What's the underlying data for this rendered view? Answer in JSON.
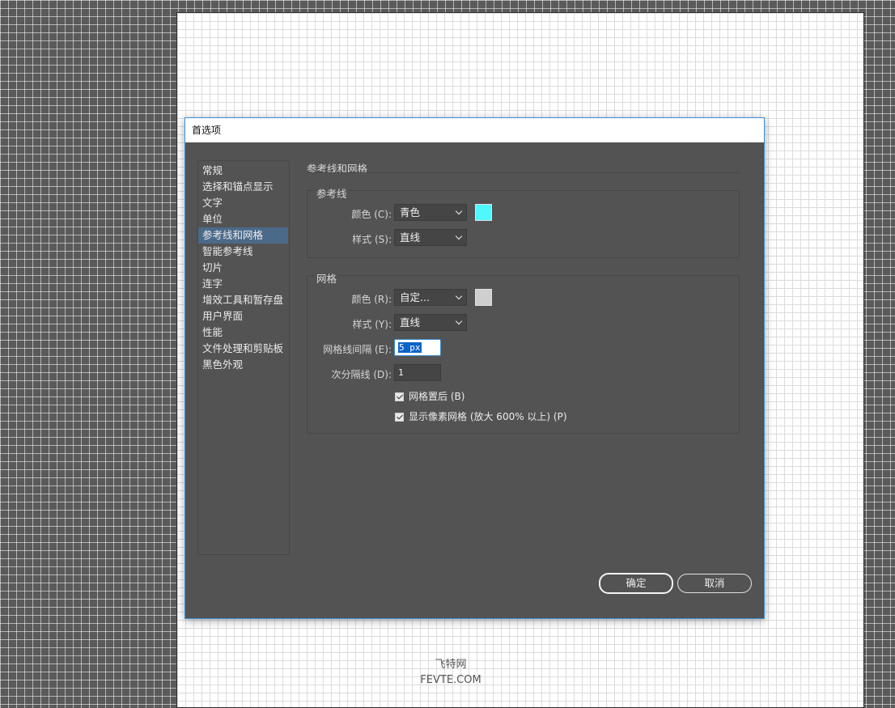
{
  "dialog": {
    "title": "首选项"
  },
  "sidebar": {
    "items": [
      {
        "label": "常规"
      },
      {
        "label": "选择和锚点显示"
      },
      {
        "label": "文字"
      },
      {
        "label": "单位"
      },
      {
        "label": "参考线和网格",
        "active": true
      },
      {
        "label": "智能参考线"
      },
      {
        "label": "切片"
      },
      {
        "label": "连字"
      },
      {
        "label": "增效工具和暂存盘"
      },
      {
        "label": "用户界面"
      },
      {
        "label": "性能"
      },
      {
        "label": "文件处理和剪贴板"
      },
      {
        "label": "黑色外观"
      }
    ]
  },
  "section_title": "参考线和网格",
  "guides": {
    "title": "参考线",
    "color_label": "颜色 (C):",
    "color_value": "青色",
    "color_swatch": "#4ff7ff",
    "style_label": "样式 (S):",
    "style_value": "直线"
  },
  "grid": {
    "title": "网格",
    "color_label": "颜色 (R):",
    "color_value": "自定...",
    "color_swatch": "#cfcfcf",
    "style_label": "样式 (Y):",
    "style_value": "直线",
    "spacing_label": "网格线间隔 (E):",
    "spacing_value": "5 px",
    "subdivisions_label": "次分隔线 (D):",
    "subdivisions_value": "1",
    "grids_in_back_label": "网格置后 (B)",
    "grids_in_back_checked": true,
    "pixel_grid_label": "显示像素网格 (放大 600% 以上) (P)",
    "pixel_grid_checked": true
  },
  "buttons": {
    "ok": "确定",
    "cancel": "取消"
  },
  "watermark": {
    "line1": "飞特网",
    "line2": "FEVTE.COM"
  }
}
